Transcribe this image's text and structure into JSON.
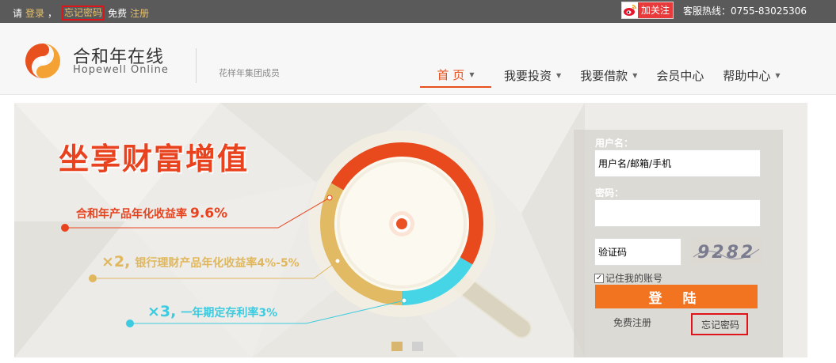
{
  "topbar": {
    "please": "请",
    "login": "登录",
    "comma": "，",
    "forgot_password": "忘记密码",
    "free": "免费",
    "register": "注册",
    "follow": "加关注",
    "hotline": "客服热线：0755-83025306"
  },
  "header": {
    "logo_cn": "合和年在线",
    "logo_en": "Hopewell Online",
    "group_member": "花样年集团成员",
    "nav": [
      {
        "label": "首 页",
        "has_dropdown": true,
        "active": true
      },
      {
        "label": "我要投资",
        "has_dropdown": true
      },
      {
        "label": "我要借款",
        "has_dropdown": true
      },
      {
        "label": "会员中心",
        "has_dropdown": false
      },
      {
        "label": "帮助中心",
        "has_dropdown": true
      }
    ]
  },
  "banner": {
    "slogan": "坐享财富增值",
    "line1_text": "合和年产品年化收益率",
    "line1_rate": "9.6%",
    "line2_mult": "×2,",
    "line2_text": "银行理财产品年化收益率4%-5%",
    "line3_mult": "×3,",
    "line3_text": "一年期定存利率3%",
    "donut_segments": [
      {
        "color": "#e8491d",
        "portion": 0.5
      },
      {
        "color": "#45d5e6",
        "portion": 0.167
      },
      {
        "color": "#e2ba63",
        "portion": 0.333
      }
    ]
  },
  "login": {
    "username_label": "用户名：",
    "username_placeholder": "用户名/邮箱/手机",
    "password_label": "密码：",
    "captcha_placeholder": "验证码",
    "captcha_text": "9282",
    "remember_label": "记住我的账号",
    "submit": "登 陆",
    "free_register": "免费注册",
    "forgot_password": "忘记密码"
  },
  "colors": {
    "brand_orange": "#e8501e",
    "topbar_bg": "#5a5a5a",
    "highlight_red": "#e0141b",
    "login_button": "#f37420"
  }
}
